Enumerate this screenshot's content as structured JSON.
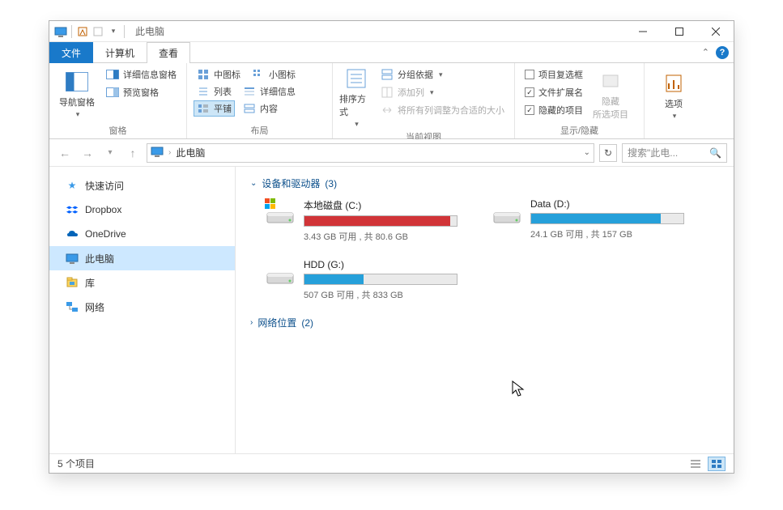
{
  "title": "此电脑",
  "tabs": {
    "file": "文件",
    "computer": "计算机",
    "view": "查看"
  },
  "ribbon": {
    "panes": {
      "nav_pane": "导航窗格",
      "preview_pane": "预览窗格",
      "details_pane": "详细信息窗格",
      "group_label": "窗格"
    },
    "layout": {
      "medium_icons": "中图标",
      "small_icons": "小图标",
      "list": "列表",
      "details": "详细信息",
      "tiles": "平铺",
      "content": "内容",
      "group_label": "布局"
    },
    "current_view": {
      "sort": "排序方式",
      "group_by": "分组依据",
      "add_columns": "添加列",
      "size_all": "将所有列调整为合适的大小",
      "group_label": "当前视图"
    },
    "show_hide": {
      "item_checkboxes": "项目复选框",
      "file_ext": "文件扩展名",
      "hidden_items": "隐藏的项目",
      "hide_selected": "隐藏\n所选项目",
      "group_label": "显示/隐藏"
    },
    "options": "选项"
  },
  "address": {
    "crumb": "此电脑"
  },
  "search_placeholder": "搜索\"此电...",
  "sidebar": {
    "items": [
      {
        "label": "快速访问"
      },
      {
        "label": "Dropbox"
      },
      {
        "label": "OneDrive"
      },
      {
        "label": "此电脑"
      },
      {
        "label": "库"
      },
      {
        "label": "网络"
      }
    ]
  },
  "groups": {
    "devices": {
      "label": "设备和驱动器",
      "count": "(3)"
    },
    "network": {
      "label": "网络位置",
      "count": "(2)"
    }
  },
  "drives": [
    {
      "name": "本地磁盘 (C:)",
      "sub": "3.43 GB 可用 , 共 80.6 GB",
      "fill_pct": 96,
      "color": "red",
      "windows": true
    },
    {
      "name": "Data (D:)",
      "sub": "24.1 GB 可用 , 共 157 GB",
      "fill_pct": 85,
      "color": "blue",
      "windows": false
    },
    {
      "name": "HDD (G:)",
      "sub": "507 GB 可用 , 共 833 GB",
      "fill_pct": 39,
      "color": "blue",
      "windows": false
    }
  ],
  "status": {
    "items": "5 个项目"
  }
}
